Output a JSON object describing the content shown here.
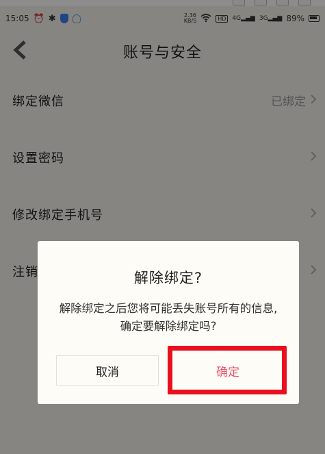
{
  "status_bar": {
    "time": "15:05",
    "net_speed_value": "2.36",
    "net_speed_unit": "KB/S",
    "hd_label": "HD",
    "signal_1": "4G",
    "signal_2": "3G",
    "battery": "89%"
  },
  "header": {
    "title": "账号与安全"
  },
  "settings": {
    "items": [
      {
        "label": "绑定微信",
        "status": "已绑定"
      },
      {
        "label": "设置密码"
      },
      {
        "label": "修改绑定手机号"
      },
      {
        "label": "注销"
      }
    ]
  },
  "dialog": {
    "title": "解除绑定?",
    "message": "解除绑定之后您将可能丢失账号所有的信息,确定要解除绑定吗?",
    "cancel_label": "取消",
    "confirm_label": "确定"
  },
  "colors": {
    "confirm_text": "#e5566d",
    "highlight_border": "#e8101e",
    "page_bg": "#f5f3ec",
    "dialog_bg": "#fdfcf6"
  }
}
